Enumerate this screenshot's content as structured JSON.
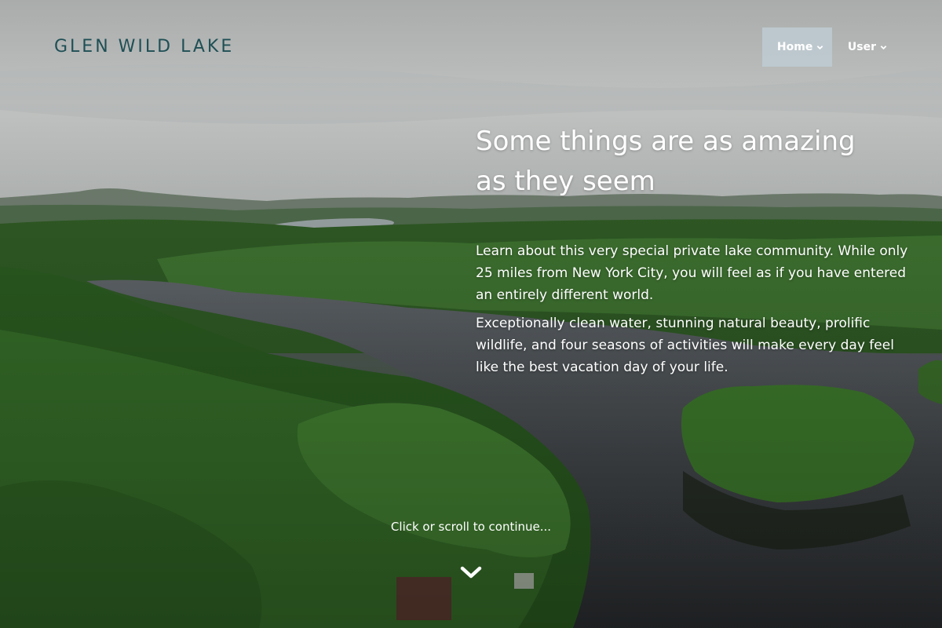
{
  "site": {
    "logo_text": "GLEN WILD LAKE"
  },
  "nav": {
    "items": [
      {
        "label": "Home",
        "active": true,
        "icon": "chevron-down-icon"
      },
      {
        "label": "User",
        "active": false,
        "icon": "chevron-down-icon"
      }
    ]
  },
  "hero": {
    "headline": "Some things are as amazing as they seem",
    "paragraphs": [
      "Learn about this very special private lake community. While only 25 miles from New York City, you will feel as if you have entered an entirely different world.",
      "Exceptionally clean water, stunning natural beauty, prolific wildlife, and four seasons of activities will make every day feel like the best vacation day of your life."
    ],
    "scroll_prompt": "Click or scroll to continue...",
    "scroll_icon": "chevron-down-icon"
  },
  "colors": {
    "logo": "#1f4f55",
    "nav_active_bg": "#becbd2",
    "text": "#ffffff"
  }
}
